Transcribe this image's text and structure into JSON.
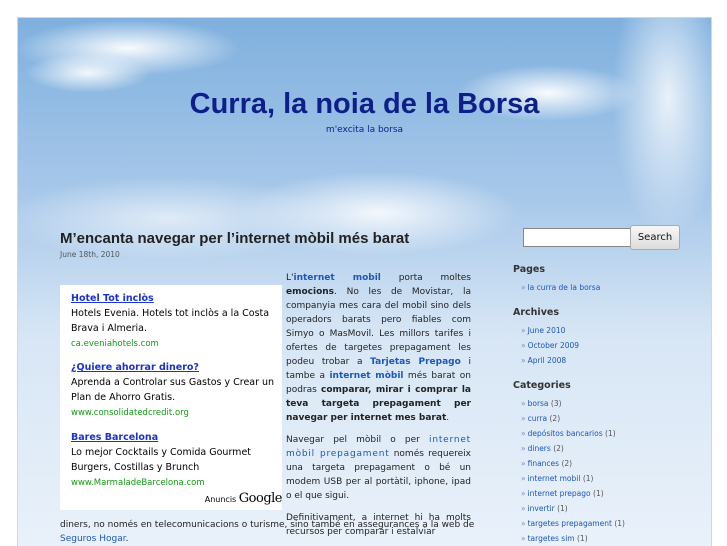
{
  "header": {
    "title": "Curra, la noia de la Borsa",
    "tagline": "m'excita la borsa"
  },
  "post": {
    "title": "M’encanta navegar per l’internet mòbil més barat",
    "date": "June 18th, 2010",
    "p1": {
      "t1": "L'",
      "l1": "internet mobil",
      "t2": " porta moltes ",
      "b1": "emocions",
      "t3": ". No les de Movistar, la companyia mes cara del mobil sino dels operadors barats pero fiables com Simyo o MasMovil. Les millors tarifes i ofertes de targetes prepagament les podeu trobar a ",
      "l2": "Tarjetas Prepago",
      "t4": " i tambe a ",
      "l3": "internet mòbil",
      "t5": " més barat on podras ",
      "b2": "comparar, mirar i comprar la teva targeta prepagament per navegar per internet mes barat",
      "t6": "."
    },
    "p2": {
      "t1": "Navegar pel mòbil o per ",
      "l1": "internet mòbil prepagament",
      "t2": " només requereix una targeta prepagament o bé un modem USB per al portàtil, iphone, ipad o el que sigui."
    },
    "p3": {
      "t1": "Definitivament, a internet hi ha molts recursos per comparar i estalviar",
      "t2": "diners, no només en telecomunicacions o turisme, sino també en assegurances a la web de ",
      "l1": "Seguros Hogar",
      "t3": "."
    }
  },
  "ads": {
    "items": [
      {
        "title": "Hotel Tot inclòs",
        "text": "Hotels Evenia. Hotels tot inclòs a la Costa Brava i Almeria.",
        "url": "ca.eveniahotels.com"
      },
      {
        "title": "¿Quiere ahorrar dinero?",
        "text": "Aprenda a Controlar sus Gastos y Crear un Plan de Ahorro Gratis.",
        "url": "www.consolidatedcredit.org"
      },
      {
        "title": "Bares Barcelona",
        "text": "Lo mejor Cocktails y Comida Gourmet Burgers, Costillas y Brunch",
        "url": "www.MarmaladeBarcelona.com"
      }
    ],
    "by_label": "Anuncis",
    "by_brand": "Google"
  },
  "search": {
    "value": "",
    "placeholder": "",
    "button": "Search"
  },
  "sidebar": {
    "pages": {
      "title": "Pages",
      "items": [
        {
          "label": "la curra de la borsa"
        }
      ]
    },
    "archives": {
      "title": "Archives",
      "items": [
        {
          "label": "June 2010"
        },
        {
          "label": "October 2009"
        },
        {
          "label": "April 2008"
        }
      ]
    },
    "categories": {
      "title": "Categories",
      "items": [
        {
          "label": "borsa",
          "count": "(3)"
        },
        {
          "label": "curra",
          "count": "(2)"
        },
        {
          "label": "depósitos bancarios",
          "count": "(1)"
        },
        {
          "label": "diners",
          "count": "(2)"
        },
        {
          "label": "finances",
          "count": "(2)"
        },
        {
          "label": "internet mobil",
          "count": "(1)"
        },
        {
          "label": "internet prepago",
          "count": "(1)"
        },
        {
          "label": "invertir",
          "count": "(1)"
        },
        {
          "label": "targetes prepagament",
          "count": "(1)"
        },
        {
          "label": "targetes sim",
          "count": "(1)"
        }
      ]
    },
    "bullet": "»"
  }
}
